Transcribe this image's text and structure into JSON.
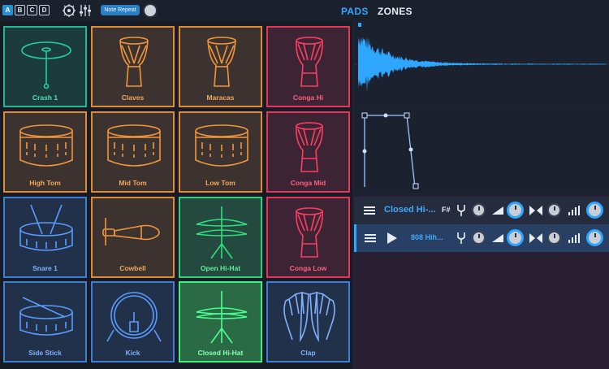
{
  "toolbar": {
    "banks": [
      {
        "label": "A",
        "active": true
      },
      {
        "label": "B",
        "active": false
      },
      {
        "label": "C",
        "active": false
      },
      {
        "label": "D",
        "active": false
      }
    ],
    "note_repeat_label": "Note Repeat"
  },
  "tabs": {
    "pads": "PADS",
    "zones": "ZONES",
    "active": "PADS"
  },
  "pads": [
    {
      "label": "Crash 1",
      "color": "teal",
      "icon": "crash-cymbal-icon"
    },
    {
      "label": "Claves",
      "color": "brown",
      "icon": "djembe-icon"
    },
    {
      "label": "Maracas",
      "color": "brown",
      "icon": "djembe-icon"
    },
    {
      "label": "Conga Hi",
      "color": "red",
      "icon": "conga-icon"
    },
    {
      "label": "High Tom",
      "color": "brown",
      "icon": "tom-drum-icon"
    },
    {
      "label": "Mid Tom",
      "color": "brown",
      "icon": "tom-drum-icon"
    },
    {
      "label": "Low Tom",
      "color": "brown",
      "icon": "tom-drum-icon"
    },
    {
      "label": "Conga Mid",
      "color": "red",
      "icon": "conga-icon"
    },
    {
      "label": "Snare 1",
      "color": "blue",
      "icon": "snare-drum-icon"
    },
    {
      "label": "Cowbell",
      "color": "brown",
      "icon": "cowbell-icon"
    },
    {
      "label": "Open Hi-Hat",
      "color": "green",
      "icon": "hi-hat-icon"
    },
    {
      "label": "Conga Low",
      "color": "red",
      "icon": "conga-icon"
    },
    {
      "label": "Side Stick",
      "color": "blue",
      "icon": "side-stick-icon"
    },
    {
      "label": "Kick",
      "color": "blue",
      "icon": "kick-drum-icon"
    },
    {
      "label": "Closed Hi-Hat",
      "color": "bright",
      "icon": "hi-hat-icon"
    },
    {
      "label": "Clap",
      "color": "blue",
      "icon": "clap-hands-icon"
    }
  ],
  "zones": {
    "group_name": "Closed Hi-...",
    "group_key": "F#",
    "sample_name": "808 Hih..."
  },
  "colors": {
    "accent": "#2fa6ff",
    "teal": "#1fb88f",
    "orange": "#e08a34",
    "red": "#e5365a",
    "blue": "#3f7fd3",
    "green": "#2fd078"
  }
}
